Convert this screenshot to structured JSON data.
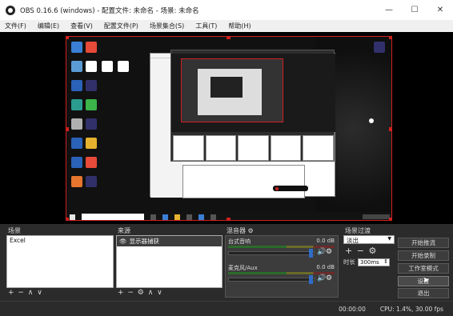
{
  "window": {
    "title": "OBS 0.16.6 (windows) - 配置文件: 未命名 - 场景: 未命名",
    "minimize": "—",
    "maximize": "☐",
    "close": "✕"
  },
  "menu": [
    "文件(F)",
    "编辑(E)",
    "查看(V)",
    "配置文件(P)",
    "场景集合(S)",
    "工具(T)",
    "帮助(H)"
  ],
  "scenes": {
    "header": "场景",
    "items": [
      "Excel"
    ],
    "footer": "+ − ∧ ∨"
  },
  "sources": {
    "header": "来源",
    "eye_icon": "eye-icon",
    "items": [
      "显示器捕获"
    ],
    "footer": "+ − ⚙ ∧ ∨"
  },
  "mixer": {
    "header": "混音器",
    "gear": "⚙",
    "rows": [
      {
        "label": "台式音响",
        "value": "0.0 dB"
      },
      {
        "label": "麦克风/Aux",
        "value": "0.0 dB"
      }
    ],
    "speaker_glyph": "🔊",
    "gear_glyph": "⚙"
  },
  "transitions": {
    "header": "场景过渡",
    "selected": "淡出",
    "plusminus": "+ −",
    "gear": "⚙",
    "duration_label": "时长",
    "duration_value": "300ms"
  },
  "controls": {
    "start_stream": "开始推流",
    "start_record": "开始录制",
    "studio_mode": "工作室模式",
    "settings": "设置",
    "exit": "退出"
  },
  "status": {
    "time": "00:00:00",
    "cpu": "CPU: 1.4%, 30.00 fps"
  }
}
